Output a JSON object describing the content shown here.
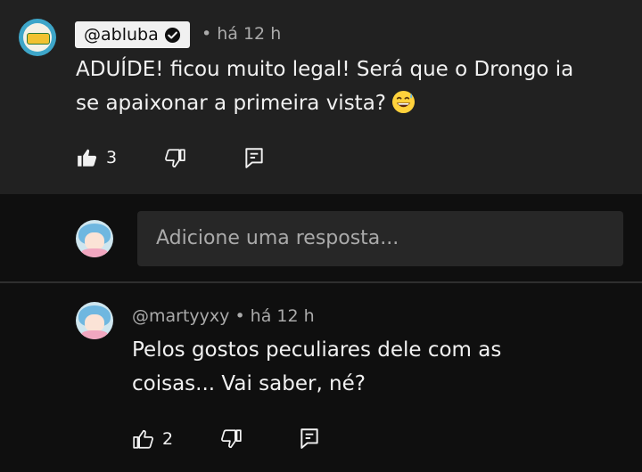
{
  "top_comment": {
    "author": "@abluba",
    "time": "• há 12 h",
    "text_line1": "ADUÍDE! ficou muito legal! Será que o Drongo ia",
    "text_line2": "se apaixonar a primeira vista?",
    "emoji": "grinning-sweat-emoji",
    "likes": "3"
  },
  "reply_input": {
    "placeholder": "Adicione uma resposta..."
  },
  "reply": {
    "author": "@martyyxy",
    "time": "• há 12 h",
    "text_line1": "Pelos gostos peculiares dele com as",
    "text_line2": "coisas... Vai saber, né?",
    "likes": "2"
  },
  "colors": {
    "top_comment_bg": "#212121",
    "page_bg": "#0f0f0f",
    "input_bg": "#272727",
    "text": "#f1f1f1",
    "muted": "#aaaaaa"
  }
}
